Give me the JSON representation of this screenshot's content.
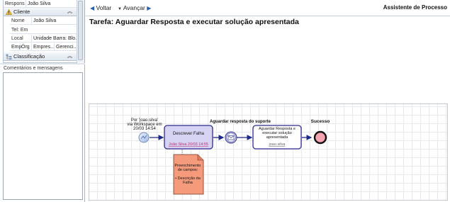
{
  "properties": {
    "requester_key": "Responsar",
    "requester_value": "João Silva",
    "client_section": "Cliente",
    "rows": [
      {
        "key": "Nome",
        "value": "João Silva"
      },
      {
        "key": "Tel: Em",
        "value": ""
      },
      {
        "key": "Local",
        "value": "Unidade Barra: Blo..."
      }
    ],
    "last_row": {
      "c1": "Emp",
      "c2": "Órg",
      "c3": "Empres...",
      "c4": "Gerenci..."
    },
    "classification_section": "Classificação"
  },
  "comments": {
    "title": "Comentários e mensagens"
  },
  "toolbar": {
    "back_label": "Voltar",
    "forward_label": "Avançar",
    "assistant_label": "Assistente de Processo"
  },
  "task": {
    "title": "Tarefa: Aguardar Resposta e executar solução apresentada"
  },
  "diagram": {
    "start_note_line1": "Por 'joao.silva'",
    "start_note_line2": "via Workspace em",
    "start_note_line3": "20/03 14:54",
    "task1_label": "Descrever Falha",
    "task1_user": "João Silva 20/03 14:55",
    "wait_label": "Aguardar resposta do suporte",
    "task2_line1": "Aguardar Resposta e",
    "task2_line2": "executar solução",
    "task2_line3": "apresentada",
    "task2_user": "joao.silva",
    "end_label": "Sucesso",
    "note_line1": "Preenchimento",
    "note_line2": "de campos:",
    "note_line3": "",
    "note_line4": "• Descrição da",
    "note_line5": "Falha"
  },
  "colors": {
    "task1_fill": "#d6d3f3",
    "task_border": "#2e2b8f",
    "note_fill": "#f59b7c",
    "end_fill": "#f4a3b0",
    "arrow": "#1d2a8a",
    "link": "#c0306a"
  }
}
